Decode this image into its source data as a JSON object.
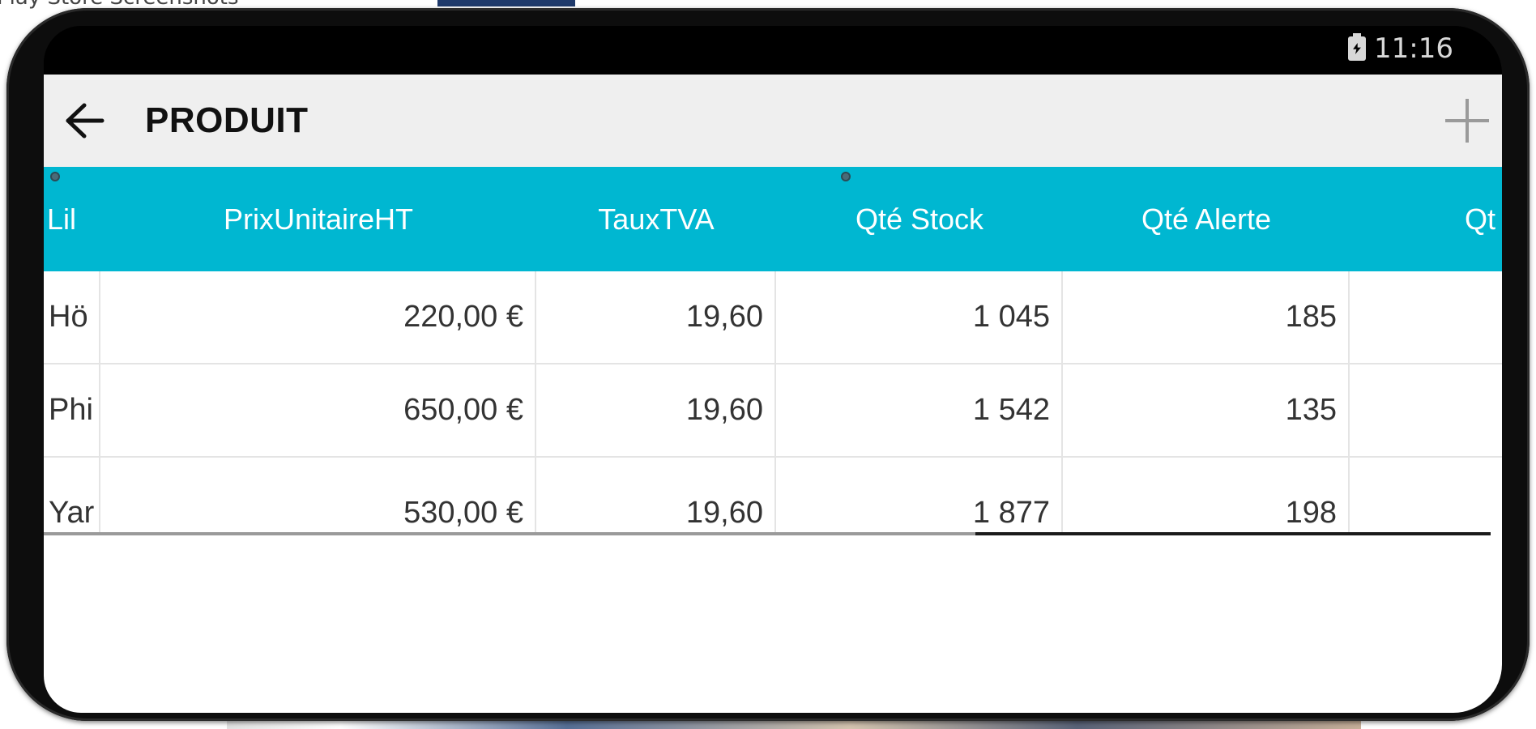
{
  "background": {
    "partial_text": "Play Store Screenshots"
  },
  "status_bar": {
    "time": "11:16",
    "battery_icon": "battery-charging-icon"
  },
  "toolbar": {
    "back_icon": "arrow-left-icon",
    "title": "PRODUIT",
    "add_icon": "plus-icon"
  },
  "colors": {
    "header_bg": "#00b7d1",
    "toolbar_bg": "#efefef",
    "text": "#333333"
  },
  "table": {
    "columns": [
      "Lil",
      "PrixUnitaireHT",
      "TauxTVA",
      "Qté Stock",
      "Qté Alerte",
      "Qt"
    ],
    "rows": [
      [
        "Hö",
        "220,00 €",
        "19,60",
        "1 045",
        "185",
        ""
      ],
      [
        "Phi",
        "650,00 €",
        "19,60",
        "1 542",
        "135",
        ""
      ],
      [
        "Yar",
        "530,00 €",
        "19,60",
        "1 877",
        "198",
        ""
      ]
    ]
  }
}
